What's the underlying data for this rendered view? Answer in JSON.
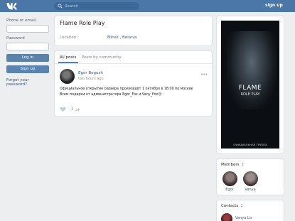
{
  "header": {
    "search_placeholder": "Search",
    "signup_label": "sign up"
  },
  "login": {
    "phone_label": "Phone or email",
    "password_label": "Password",
    "login_button": "Log in",
    "signup_button": "Sign up",
    "forgot_link": "Forgot your password?"
  },
  "group": {
    "title": "Flame Role Play",
    "location_label": "Location:",
    "location_value": "Minsk , Belarus"
  },
  "posts": {
    "tabs": [
      "All posts",
      "Posts by community"
    ],
    "post": {
      "author": "Egor Bogush",
      "time": "two hours ago",
      "text_line1": "Официальное открытие сервера произойдёт 1 октября в 18:00 по москве",
      "text_line2": "Всем подарки от администратора Egor_Fox и Vany_Fox😊",
      "likes": "1"
    }
  },
  "poster": {
    "title": "FLAME",
    "subtitle": "ROLE PLAY",
    "caption": "ОФИЦИАЛЬНАЯ ГРУППА"
  },
  "members": {
    "title": "Members",
    "count": "2",
    "people": [
      {
        "name": "Egor"
      },
      {
        "name": "Vanya"
      }
    ]
  },
  "contacts": {
    "title": "Contacts",
    "count": "1",
    "people": [
      {
        "name": "Vanya Lis"
      }
    ]
  },
  "colors": {
    "header_bg": "#4a76a8",
    "page_bg": "#edeef0",
    "link": "#2a5885",
    "button": "#5e81a8"
  },
  "icons": [
    "vk-logo-icon",
    "search-icon",
    "more-icon",
    "heart-icon",
    "share-icon"
  ]
}
